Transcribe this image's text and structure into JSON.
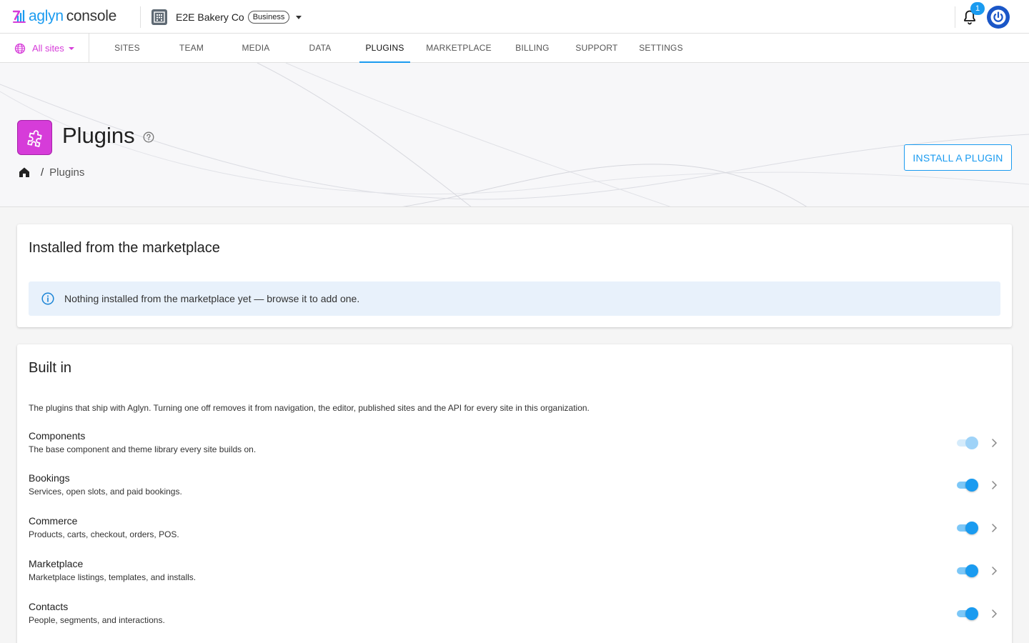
{
  "header": {
    "brand": "aglyn",
    "product": "console",
    "org_name": "E2E Bakery Co",
    "org_plan": "Business",
    "notification_count": "1"
  },
  "nav": {
    "site_selector": "All sites",
    "tabs": [
      "SITES",
      "TEAM",
      "MEDIA",
      "DATA",
      "PLUGINS",
      "MARKETPLACE",
      "BILLING",
      "SUPPORT",
      "SETTINGS"
    ],
    "active_tab": "PLUGINS"
  },
  "hero": {
    "title": "Plugins",
    "breadcrumb_current": "Plugins",
    "breadcrumb_separator": "/",
    "install_button": "INSTALL A PLUGIN"
  },
  "marketplace_section": {
    "title": "Installed from the marketplace",
    "empty_message": "Nothing installed from the marketplace yet — browse it to add one."
  },
  "builtin_section": {
    "title": "Built in",
    "description": "The plugins that ship with Aglyn. Turning one off removes it from navigation, the editor, published sites and the API for every site in this organization.",
    "plugins": [
      {
        "name": "Components",
        "description": "The base component and theme library every site builds on.",
        "enabled": true,
        "locked": true
      },
      {
        "name": "Bookings",
        "description": "Services, open slots, and paid bookings.",
        "enabled": true,
        "locked": false
      },
      {
        "name": "Commerce",
        "description": "Products, carts, checkout, orders, POS.",
        "enabled": true,
        "locked": false
      },
      {
        "name": "Marketplace",
        "description": "Marketplace listings, templates, and installs.",
        "enabled": true,
        "locked": false
      },
      {
        "name": "Contacts",
        "description": "People, segments, and interactions.",
        "enabled": true,
        "locked": false
      }
    ]
  },
  "colors": {
    "accent": "#1a9bf0",
    "plugin_brand": "#d63cd9",
    "info_bg": "#e8f1fb"
  },
  "icons": [
    "aglyn-logo-icon",
    "building-icon",
    "bell-icon",
    "power-icon",
    "globe-icon",
    "puzzle-icon",
    "help-circle-icon",
    "home-icon",
    "info-icon",
    "chevron-right-icon"
  ]
}
